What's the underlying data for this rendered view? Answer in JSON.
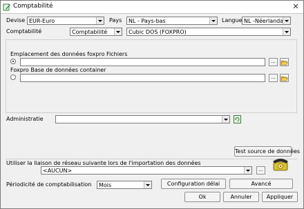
{
  "window": {
    "title": "Comptabilité"
  },
  "row1": {
    "devise_label": "Devise",
    "devise_value": "EUR-Euro",
    "pays_label": "Pays",
    "pays_value": "NL - Pays-bas",
    "langue_label": "Langue",
    "langue_value": "NL -Néerlandais"
  },
  "row2": {
    "comptabilite_label": "Comptabilité",
    "comptabilite_value": "Comptabilité",
    "system_value": "Cubic DOS (FOXPRO)"
  },
  "foxpro": {
    "emplacement_label": "Emplacement des données foxpro Fichiers",
    "emplacement_value": "",
    "container_label": "Foxpro Base de données container",
    "container_value": "",
    "browse_label": "..."
  },
  "administratie": {
    "label": "Administratie",
    "value": ""
  },
  "test_button": "Test source de données",
  "network": {
    "label": "Utiliser la liaison de réseau suivante lors de l'importation des données",
    "value": "<AUCUN>",
    "browse_label": "..."
  },
  "periodicite": {
    "label": "Périodicité de comptabilisation",
    "value": "Mois",
    "config_button": "Configuration délai",
    "avance_button": "Avancé"
  },
  "footer": {
    "ok": "Ok",
    "annuler": "Annuler",
    "appliquer": "Appliquer"
  },
  "icons": {
    "app": "pencil-doc-icon",
    "close": "close-icon",
    "folder": "open-folder-icon",
    "refresh": "refresh-icon",
    "phone": "telephone-icon"
  }
}
